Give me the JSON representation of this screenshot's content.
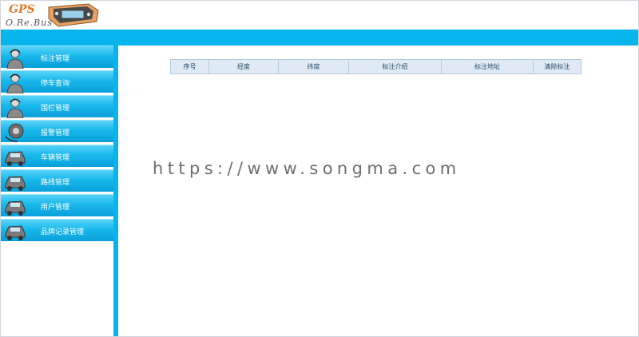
{
  "header": {
    "logo_top": "GPS",
    "logo_bottom": "O.Re.Bus"
  },
  "sidebar": {
    "items": [
      {
        "label": "标注管理",
        "icon": "operator-icon"
      },
      {
        "label": "停车查询",
        "icon": "operator-icon"
      },
      {
        "label": "围栏管理",
        "icon": "operator-icon"
      },
      {
        "label": "报警管理",
        "icon": "alarm-icon"
      },
      {
        "label": "车辆管理",
        "icon": "vehicle-icon"
      },
      {
        "label": "路线管理",
        "icon": "vehicle-icon"
      },
      {
        "label": "用户管理",
        "icon": "vehicle-icon"
      },
      {
        "label": "品牌记录管理",
        "icon": "vehicle-icon"
      }
    ]
  },
  "table": {
    "columns": [
      "序号",
      "经度",
      "纬度",
      "标注介绍",
      "标注地址",
      "清除标注"
    ]
  },
  "watermark": "https://www.songma.com",
  "colors": {
    "accent": "#08b4ec",
    "menu_gradient_top": "#5ad3f7",
    "menu_gradient_bottom": "#0a9fd9",
    "table_header": "#dfeaf5"
  }
}
